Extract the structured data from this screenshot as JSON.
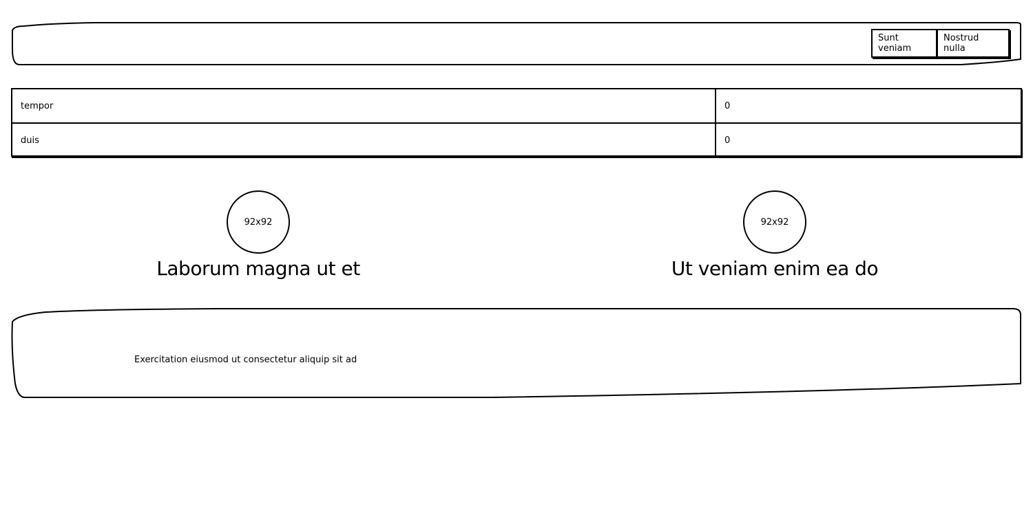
{
  "header": {
    "buttons": [
      {
        "label": "Sunt veniam"
      },
      {
        "label": "Nostrud nulla"
      }
    ]
  },
  "table": {
    "rows": [
      {
        "name": "tempor",
        "value": "0"
      },
      {
        "name": "duis",
        "value": "0"
      }
    ]
  },
  "features": [
    {
      "image_label": "92x92",
      "title": "Laborum magna ut et"
    },
    {
      "image_label": "92x92",
      "title": "Ut veniam enim ea do"
    }
  ],
  "footer": {
    "text": "Exercitation eiusmod ut consectetur aliquip sit ad"
  }
}
